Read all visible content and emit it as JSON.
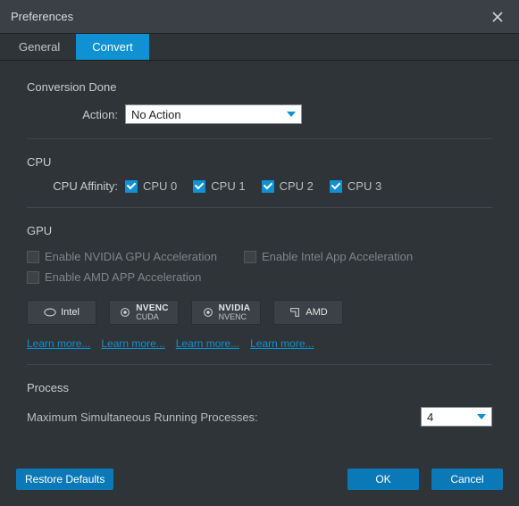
{
  "window": {
    "title": "Preferences"
  },
  "tabs": {
    "general": "General",
    "convert": "Convert",
    "active": "convert"
  },
  "sections": {
    "conversion_done": {
      "label": "Conversion Done",
      "action_label": "Action:",
      "action_value": "No Action"
    },
    "cpu": {
      "label": "CPU",
      "affinity_label": "CPU Affinity:",
      "cores": [
        {
          "label": "CPU 0",
          "checked": true
        },
        {
          "label": "CPU 1",
          "checked": true
        },
        {
          "label": "CPU 2",
          "checked": true
        },
        {
          "label": "CPU 3",
          "checked": true
        }
      ]
    },
    "gpu": {
      "label": "GPU",
      "options": {
        "nvidia": {
          "label": "Enable NVIDIA GPU Acceleration",
          "checked": false,
          "enabled": false
        },
        "intel": {
          "label": "Enable Intel App Acceleration",
          "checked": false,
          "enabled": false
        },
        "amd": {
          "label": "Enable AMD APP Acceleration",
          "checked": false,
          "enabled": false
        }
      },
      "buttons": {
        "intel": "Intel",
        "nvenc_cuda_top": "NVENC",
        "nvenc_cuda_bot": "CUDA",
        "nvidia_nvenc_top": "NVIDIA",
        "nvidia_nvenc_bot": "NVENC",
        "amd": "AMD"
      },
      "learn_more": "Learn more..."
    },
    "process": {
      "label": "Process",
      "max_label": "Maximum Simultaneous Running Processes:",
      "max_value": "4"
    }
  },
  "footer": {
    "restore": "Restore Defaults",
    "ok": "OK",
    "cancel": "Cancel"
  }
}
